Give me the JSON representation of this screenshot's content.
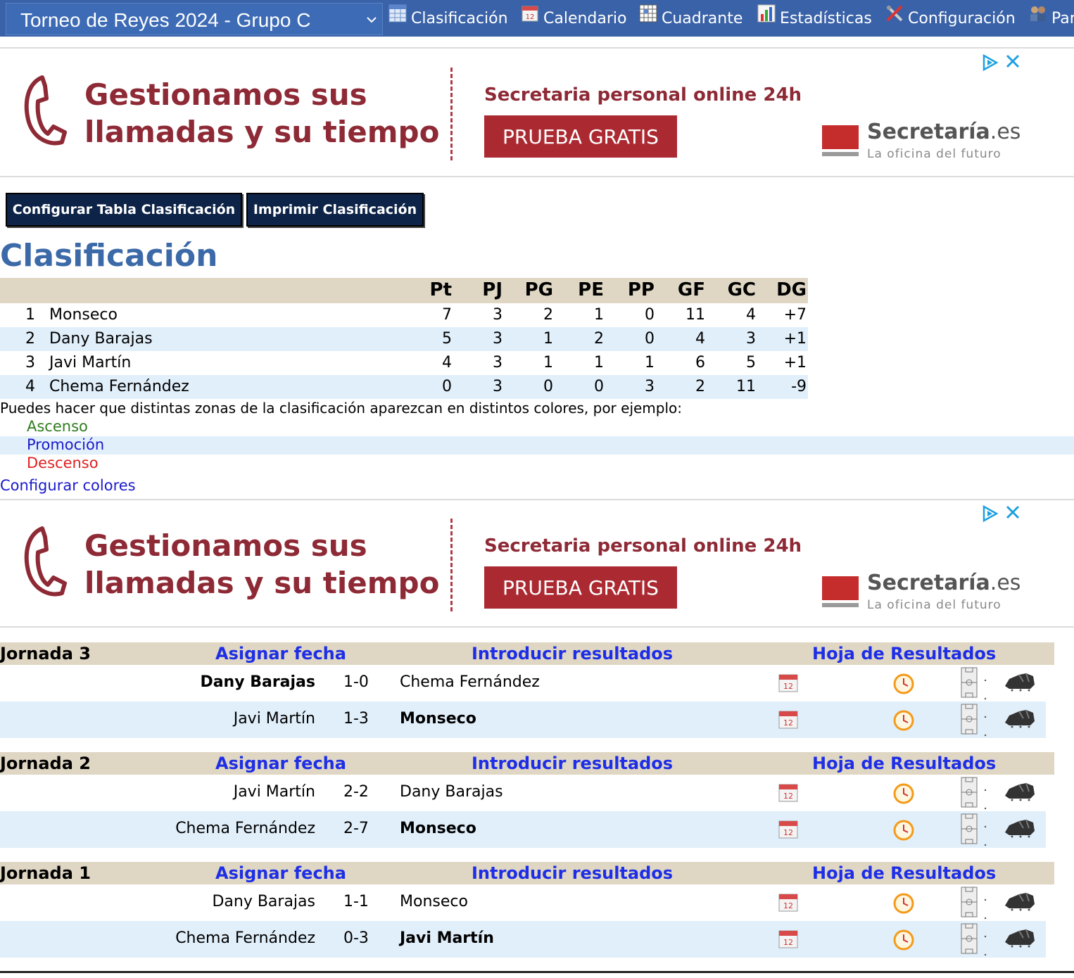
{
  "topbar": {
    "group_select": "Torneo de Reyes 2024 - Grupo C",
    "nav": [
      {
        "label": "Clasificación",
        "icon": "table-icon"
      },
      {
        "label": "Calendario",
        "icon": "calendar-icon"
      },
      {
        "label": "Cuadrante",
        "icon": "grid-icon"
      },
      {
        "label": "Estadísticas",
        "icon": "bar-chart-icon"
      },
      {
        "label": "Configuración",
        "icon": "tools-icon"
      },
      {
        "label": "Par",
        "icon": "people-icon"
      }
    ]
  },
  "ad": {
    "headline_1": "Gestionamos sus",
    "headline_2": "llamadas y su tiempo",
    "sub": "Secretaria personal online 24h",
    "cta": "PRUEBA GRATIS",
    "brand": "Secretaría",
    "brand_suffix": ".es",
    "tagline": "La oficina del futuro",
    "brand_color": "#8e2a36"
  },
  "buttons": {
    "configure": "Configurar Tabla Clasificación",
    "print": "Imprimir Clasificación"
  },
  "title": "Clasificación",
  "standings": {
    "columns": [
      "Pt",
      "PJ",
      "PG",
      "PE",
      "PP",
      "GF",
      "GC",
      "DG"
    ],
    "rows": [
      {
        "pos": "1",
        "team": "Monseco",
        "stats": [
          "7",
          "3",
          "2",
          "1",
          "0",
          "11",
          "4",
          "+7"
        ]
      },
      {
        "pos": "2",
        "team": "Dany Barajas",
        "stats": [
          "5",
          "3",
          "1",
          "2",
          "0",
          "4",
          "3",
          "+1"
        ]
      },
      {
        "pos": "3",
        "team": "Javi Martín",
        "stats": [
          "4",
          "3",
          "1",
          "1",
          "1",
          "6",
          "5",
          "+1"
        ]
      },
      {
        "pos": "4",
        "team": "Chema Fernández",
        "stats": [
          "0",
          "3",
          "0",
          "0",
          "3",
          "2",
          "11",
          "-9"
        ]
      }
    ]
  },
  "color_note": "Puedes hacer que distintas zonas de la clasificación aparezcan en distintos colores, por ejemplo:",
  "zones": {
    "ascenso": {
      "label": "Ascenso",
      "color": "#2e7d1e"
    },
    "promocion": {
      "label": "Promoción",
      "color": "#1a1acc"
    },
    "descenso": {
      "label": "Descenso",
      "color": "#e02020"
    }
  },
  "configure_colors": "Configurar colores",
  "rounds": [
    {
      "title": "Jornada 3",
      "assign_date": "Asignar fecha",
      "enter_results": "Introducir resultados",
      "results_sheet": "Hoja de Resultados",
      "matches": [
        {
          "home": "Dany Barajas",
          "score": "1-0",
          "away": "Chema Fernández",
          "winner": "home"
        },
        {
          "home": "Javi Martín",
          "score": "1-3",
          "away": "Monseco",
          "winner": "away"
        }
      ]
    },
    {
      "title": "Jornada 2",
      "assign_date": "Asignar fecha",
      "enter_results": "Introducir resultados",
      "results_sheet": "Hoja de Resultados",
      "matches": [
        {
          "home": "Javi Martín",
          "score": "2-2",
          "away": "Dany Barajas",
          "winner": "none"
        },
        {
          "home": "Chema Fernández",
          "score": "2-7",
          "away": "Monseco",
          "winner": "away"
        }
      ]
    },
    {
      "title": "Jornada 1",
      "assign_date": "Asignar fecha",
      "enter_results": "Introducir resultados",
      "results_sheet": "Hoja de Resultados",
      "matches": [
        {
          "home": "Dany Barajas",
          "score": "1-1",
          "away": "Monseco",
          "winner": "none"
        },
        {
          "home": "Chema Fernández",
          "score": "0-3",
          "away": "Javi Martín",
          "winner": "away"
        }
      ]
    }
  ]
}
